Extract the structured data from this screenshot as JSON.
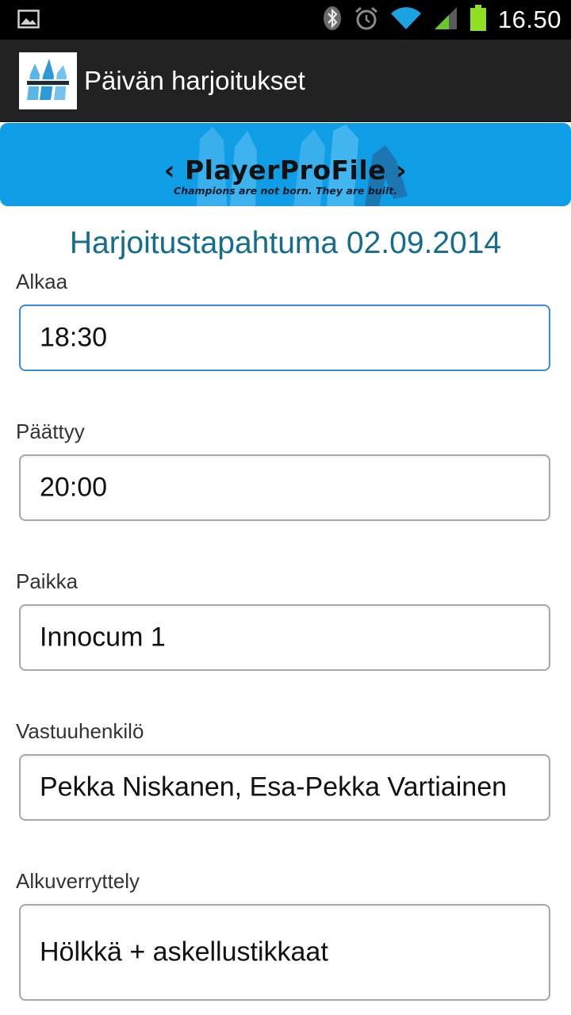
{
  "status_bar": {
    "time": "16.50",
    "icons": [
      "gallery-icon",
      "bluetooth-icon",
      "alarm-icon",
      "wifi-icon",
      "signal-icon",
      "battery-icon"
    ],
    "battery_color": "#8fe023"
  },
  "action_bar": {
    "title": "Päivän harjoitukset",
    "logo_icon": "playerprofile-logo-icon"
  },
  "banner": {
    "brand": "‹ PlayerProFile ›",
    "tagline": "Champions are not born. They are built.",
    "background_color": "#0f9ee6"
  },
  "page": {
    "title": "Harjoitustapahtuma 02.09.2014",
    "title_color": "#126d8e"
  },
  "fields": [
    {
      "label": "Alkaa",
      "value": "18:30",
      "focused": true
    },
    {
      "label": "Päättyy",
      "value": "20:00",
      "focused": false
    },
    {
      "label": "Paikka",
      "value": "Innocum 1",
      "focused": false
    },
    {
      "label": "Vastuuhenkilö",
      "value": "Pekka Niskanen, Esa-Pekka Vartiainen",
      "focused": false
    },
    {
      "label": "Alkuverryttely",
      "value": "Hölkkä + askellustikkaat",
      "focused": false
    }
  ]
}
